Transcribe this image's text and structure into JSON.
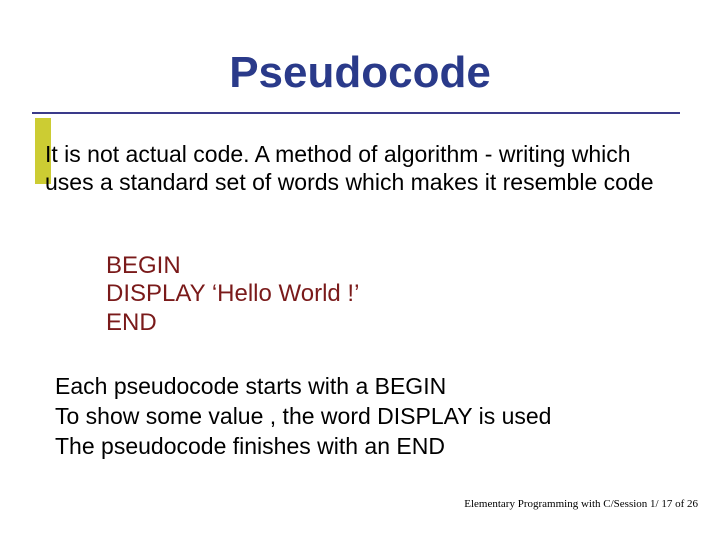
{
  "title": "Pseudocode",
  "body1": "It is not actual code. A method of algorithm - writing which uses a standard set of words which makes it resemble code",
  "code": {
    "line1": "BEGIN",
    "line2": "DISPLAY ‘Hello World !’",
    "line3": "END"
  },
  "body2": {
    "line1": "Each pseudocode starts with a BEGIN",
    "line2": "To show some value , the word DISPLAY is used",
    "line3": "The pseudocode  finishes with an END"
  },
  "footer": "Elementary Programming with C/Session 1/ 17 of 26"
}
